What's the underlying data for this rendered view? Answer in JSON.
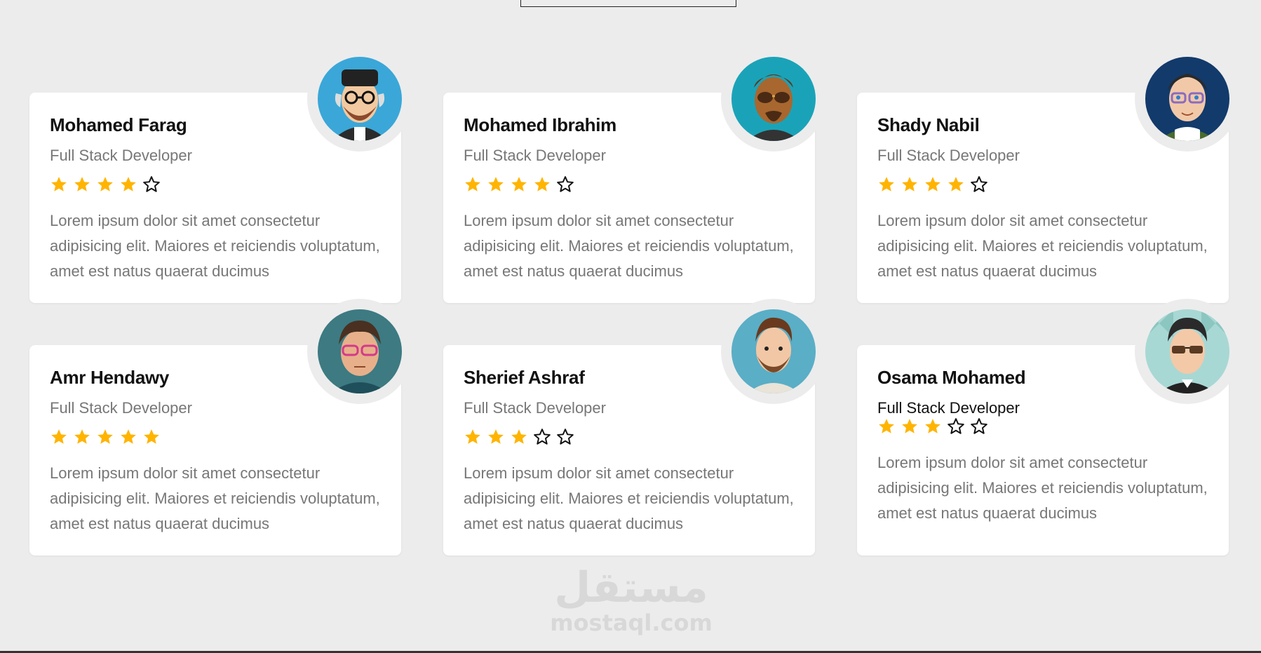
{
  "cards": [
    {
      "name": "Mohamed Farag",
      "role": "Full Stack Developer",
      "rating": 4,
      "description": "Lorem ipsum dolor sit amet consectetur adipisicing elit. Maiores et reiciendis voluptatum, amet est natus quaerat ducimus",
      "avatar_bg": "#3aa7d8"
    },
    {
      "name": "Mohamed Ibrahim",
      "role": "Full Stack Developer",
      "rating": 4,
      "description": "Lorem ipsum dolor sit amet consectetur adipisicing elit. Maiores et reiciendis voluptatum, amet est natus quaerat ducimus",
      "avatar_bg": "#1aa3b8"
    },
    {
      "name": "Shady Nabil",
      "role": "Full Stack Developer",
      "rating": 4,
      "description": "Lorem ipsum dolor sit amet consectetur adipisicing elit. Maiores et reiciendis voluptatum, amet est natus quaerat ducimus",
      "avatar_bg": "#123a6b"
    },
    {
      "name": "Amr Hendawy",
      "role": "Full Stack Developer",
      "rating": 5,
      "description": "Lorem ipsum dolor sit amet consectetur adipisicing elit. Maiores et reiciendis voluptatum, amet est natus quaerat ducimus",
      "avatar_bg": "#3d7a82"
    },
    {
      "name": "Sherief Ashraf",
      "role": "Full Stack Developer",
      "rating": 3,
      "description": "Lorem ipsum dolor sit amet consectetur adipisicing elit. Maiores et reiciendis voluptatum, amet est natus quaerat ducimus",
      "avatar_bg": "#5aaec6"
    },
    {
      "name": "Osama Mohamed",
      "role": "Full Stack Developer",
      "rating": 3,
      "description": "Lorem ipsum dolor sit amet consectetur adipisicing elit. Maiores et reiciendis voluptatum, amet est natus quaerat ducimus",
      "avatar_bg": "#a8d8d4"
    }
  ],
  "star_colors": {
    "filled": "#ffb400",
    "empty": "#111111"
  },
  "watermark": {
    "arabic": "مستقل",
    "latin": "mostaql.com"
  }
}
